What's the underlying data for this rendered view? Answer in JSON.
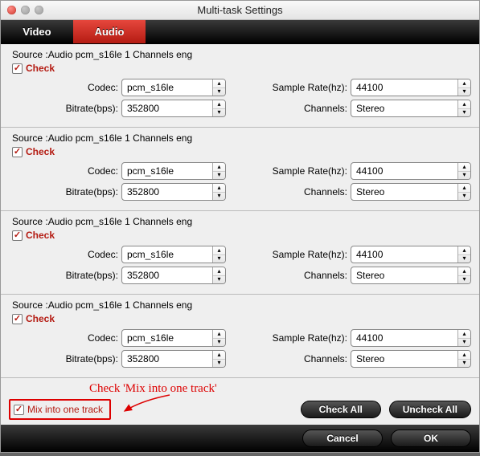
{
  "window": {
    "title": "Multi-task Settings"
  },
  "tabs": {
    "video": "Video",
    "audio": "Audio"
  },
  "labels": {
    "codec": "Codec:",
    "bitrate": "Bitrate(bps):",
    "samplerate": "Sample Rate(hz):",
    "channels": "Channels:",
    "check": "Check"
  },
  "tracks": [
    {
      "source": "Source :Audio  pcm_s16le  1 Channels  eng",
      "checked": true,
      "codec": "pcm_s16le",
      "bitrate": "352800",
      "samplerate": "44100",
      "channels": "Stereo"
    },
    {
      "source": "Source :Audio  pcm_s16le  1 Channels  eng",
      "checked": true,
      "codec": "pcm_s16le",
      "bitrate": "352800",
      "samplerate": "44100",
      "channels": "Stereo"
    },
    {
      "source": "Source :Audio  pcm_s16le  1 Channels  eng",
      "checked": true,
      "codec": "pcm_s16le",
      "bitrate": "352800",
      "samplerate": "44100",
      "channels": "Stereo"
    },
    {
      "source": "Source :Audio  pcm_s16le  1 Channels  eng",
      "checked": true,
      "codec": "pcm_s16le",
      "bitrate": "352800",
      "samplerate": "44100",
      "channels": "Stereo"
    }
  ],
  "mix": {
    "label": "Mix into one track",
    "checked": true
  },
  "annotation": "Check 'Mix into one track'",
  "buttons": {
    "check_all": "Check All",
    "uncheck_all": "Uncheck All",
    "cancel": "Cancel",
    "ok": "OK"
  }
}
